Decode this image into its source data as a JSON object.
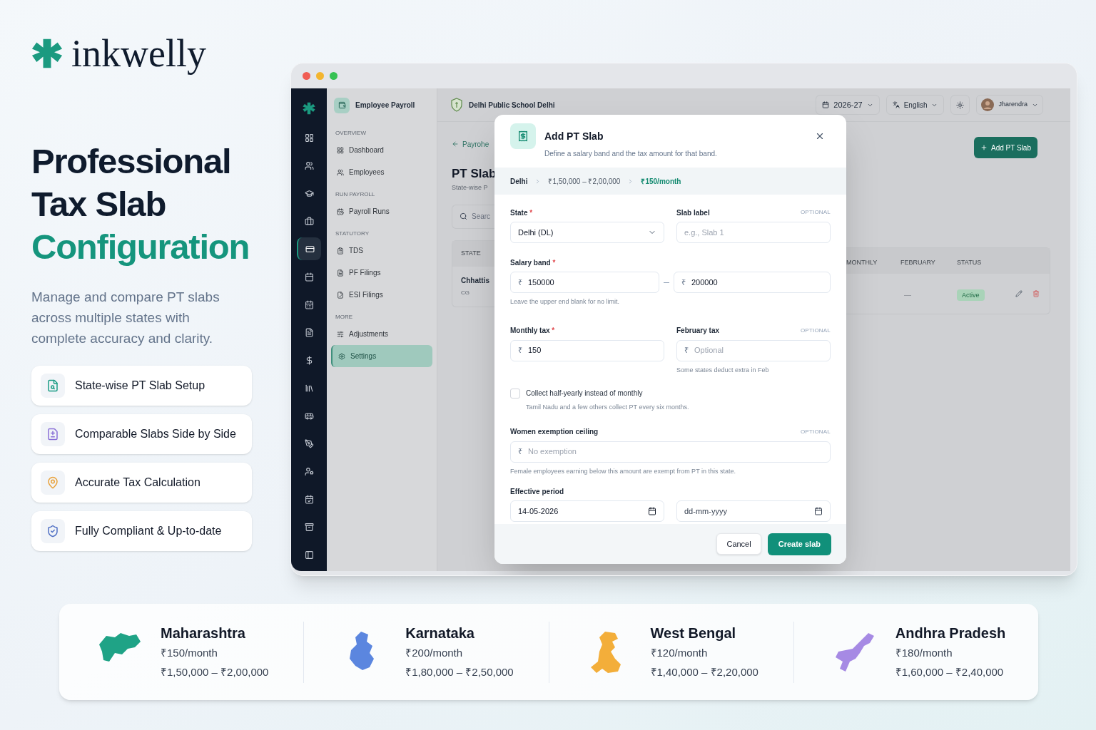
{
  "brand": {
    "name": "inkwelly"
  },
  "headline": {
    "lines": [
      "Professional",
      "Tax Slab"
    ],
    "accent": "Configuration"
  },
  "description": "Manage and compare PT slabs across multiple states with complete accuracy and clarity.",
  "features": [
    {
      "label": "State-wise PT Slab Setup",
      "color": "#1a9c84"
    },
    {
      "label": "Comparable Slabs Side by Side",
      "color": "#8a6fd6"
    },
    {
      "label": "Accurate Tax Calculation",
      "color": "#e9a23b"
    },
    {
      "label": "Fully Compliant & Up-to-date",
      "color": "#4f6fc4"
    }
  ],
  "app": {
    "rail": [
      {
        "selected": false
      },
      {
        "selected": false
      },
      {
        "selected": false
      },
      {
        "selected": false
      },
      {
        "selected": true
      },
      {
        "selected": false
      },
      {
        "selected": false
      },
      {
        "selected": false
      },
      {
        "selected": false
      },
      {
        "selected": false
      },
      {
        "selected": false
      },
      {
        "selected": false
      },
      {
        "selected": false
      },
      {
        "selected": false
      },
      {
        "selected": false
      },
      {
        "selected": false
      }
    ],
    "sidebar": {
      "title": "Employee Payroll",
      "sections": [
        {
          "heading": "OVERVIEW",
          "items": [
            {
              "label": "Dashboard",
              "selected": false
            },
            {
              "label": "Employees",
              "selected": false
            }
          ]
        },
        {
          "heading": "RUN PAYROLL",
          "items": [
            {
              "label": "Payroll Runs",
              "selected": false
            }
          ]
        },
        {
          "heading": "STATUTORY",
          "items": [
            {
              "label": "TDS",
              "selected": false
            },
            {
              "label": "PF Filings",
              "selected": false
            },
            {
              "label": "ESI Filings",
              "selected": false
            }
          ]
        },
        {
          "heading": "MORE",
          "items": [
            {
              "label": "Adjustments",
              "selected": false
            },
            {
              "label": "Settings",
              "selected": true
            }
          ]
        }
      ]
    },
    "topbar": {
      "school": "Delhi Public School Delhi",
      "year": "2026-27",
      "language": "English",
      "user": "Jharendra"
    },
    "page": {
      "back": "Payrohe",
      "title": "PT Slab",
      "subtitle": "State-wise P",
      "search_placeholder": "Searc",
      "add_button": "Add PT Slab",
      "table": {
        "left_columns": [
          "STATE"
        ],
        "right_columns": [
          "MONTHLY",
          "FEBRUARY",
          "STATUS"
        ],
        "row": {
          "state": "Chhattis",
          "code": "CG",
          "february": "—",
          "status": "Active"
        }
      }
    },
    "modal": {
      "title": "Add PT Slab",
      "subtitle": "Define a salary band and the tax amount for that band.",
      "breadcrumb": [
        "Delhi",
        "₹1,50,000 – ₹2,00,000",
        "₹150/month"
      ],
      "currency": "₹",
      "state": {
        "label": "State",
        "required_mark": "*",
        "value": "Delhi (DL)"
      },
      "slab_label": {
        "label": "Slab label",
        "tag": "OPTIONAL",
        "placeholder": "e.g., Slab 1"
      },
      "salary_band": {
        "label": "Salary band",
        "required_mark": "*",
        "from": "150000",
        "to": "200000",
        "hint": "Leave the upper end blank for no limit."
      },
      "monthly_tax": {
        "label": "Monthly tax",
        "required_mark": "*",
        "value": "150"
      },
      "february_tax": {
        "label": "February tax",
        "tag": "OPTIONAL",
        "placeholder": "Optional",
        "hint": "Some states deduct extra in Feb"
      },
      "half_yearly": {
        "label": "Collect half-yearly instead of monthly",
        "hint": "Tamil Nadu and a few others collect PT every six months.",
        "checked": false
      },
      "women_exemption": {
        "label": "Women exemption ceiling",
        "tag": "OPTIONAL",
        "placeholder": "No exemption",
        "hint": "Female employees earning below this amount are exempt from PT in this state."
      },
      "effective_period": {
        "label": "Effective period",
        "from": "14-05-2026",
        "to_placeholder": "dd-mm-yyyy"
      },
      "buttons": {
        "cancel": "Cancel",
        "create": "Create slab"
      }
    }
  },
  "states": [
    {
      "name": "Maharashtra",
      "rate": "₹150/month",
      "range": "₹1,50,000 – ₹2,00,000",
      "color": "#1fa386"
    },
    {
      "name": "Karnataka",
      "rate": "₹200/month",
      "range": "₹1,80,000 – ₹2,50,000",
      "color": "#5b86df"
    },
    {
      "name": "West Bengal",
      "rate": "₹120/month",
      "range": "₹1,40,000 – ₹2,20,000",
      "color": "#f3ae3a"
    },
    {
      "name": "Andhra Pradesh",
      "rate": "₹180/month",
      "range": "₹1,60,000 – ₹2,40,000",
      "color": "#a68ae4"
    }
  ]
}
